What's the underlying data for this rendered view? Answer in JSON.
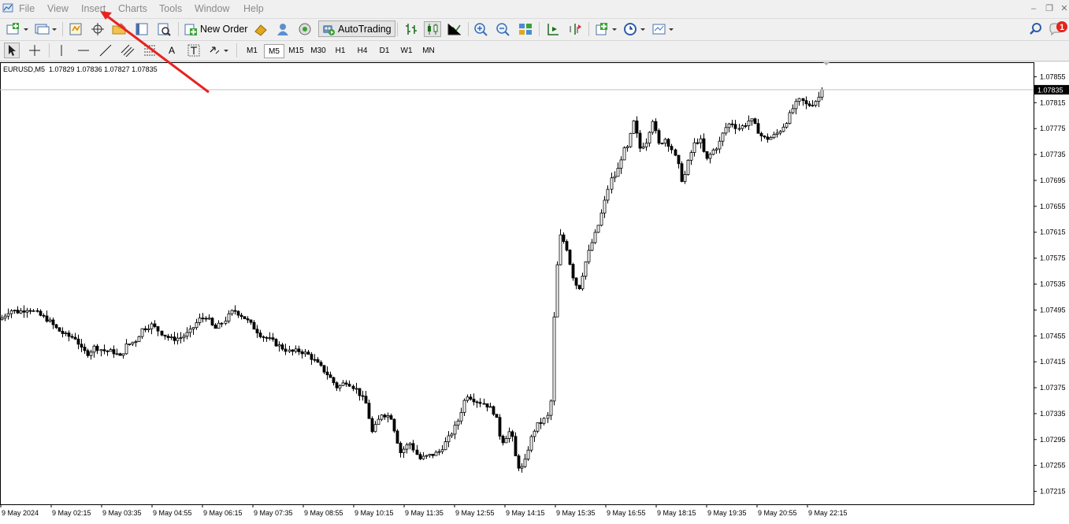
{
  "menu": {
    "file": "File",
    "view": "View",
    "insert": "Insert",
    "charts": "Charts",
    "tools": "Tools",
    "window": "Window",
    "help": "Help"
  },
  "toolbar": {
    "new_order": "New Order",
    "autotrading": "AutoTrading",
    "notification_count": "1"
  },
  "timeframes": [
    {
      "label": "M1",
      "active": false
    },
    {
      "label": "M5",
      "active": true
    },
    {
      "label": "M15",
      "active": false
    },
    {
      "label": "M30",
      "active": false
    },
    {
      "label": "H1",
      "active": false
    },
    {
      "label": "H4",
      "active": false
    },
    {
      "label": "D1",
      "active": false
    },
    {
      "label": "W1",
      "active": false
    },
    {
      "label": "MN",
      "active": false
    }
  ],
  "drawing_tools": {
    "text_tool": "A"
  },
  "chart": {
    "symbol_info": "EURUSD,M5  1.07829 1.07836 1.07827 1.07835",
    "current_price": "1.07835",
    "colors": {
      "annotation_arrow": "#e8231f",
      "notification": "#e3241c"
    }
  },
  "chart_data": {
    "type": "candlestick",
    "symbol": "EURUSD",
    "timeframe": "M5",
    "ohlc": {
      "open": 1.07829,
      "high": 1.07836,
      "low": 1.07827,
      "close": 1.07835
    },
    "ylim": [
      1.07195,
      1.07875
    ],
    "y_ticks": [
      "1.07855",
      "1.07815",
      "1.07775",
      "1.07735",
      "1.07695",
      "1.07655",
      "1.07615",
      "1.07575",
      "1.07535",
      "1.07495",
      "1.07455",
      "1.07415",
      "1.07375",
      "1.07335",
      "1.07295",
      "1.07255",
      "1.07215"
    ],
    "x_ticks": [
      "9 May 2024",
      "9 May 02:15",
      "9 May 03:35",
      "9 May 04:55",
      "9 May 06:15",
      "9 May 07:35",
      "9 May 08:55",
      "9 May 10:15",
      "9 May 11:35",
      "9 May 12:55",
      "9 May 14:15",
      "9 May 15:35",
      "9 May 16:55",
      "9 May 18:15",
      "9 May 19:35",
      "9 May 20:55",
      "9 May 22:15"
    ],
    "close_path": [
      [
        0,
        1.0748
      ],
      [
        12,
        1.07495
      ],
      [
        24,
        1.07492
      ],
      [
        36,
        1.07498
      ],
      [
        48,
        1.07488
      ],
      [
        60,
        1.0748
      ],
      [
        72,
        1.07465
      ],
      [
        84,
        1.07455
      ],
      [
        96,
        1.07452
      ],
      [
        104,
        1.07432
      ],
      [
        112,
        1.07428
      ],
      [
        120,
        1.07438
      ],
      [
        132,
        1.07432
      ],
      [
        144,
        1.0743
      ],
      [
        152,
        1.07422
      ],
      [
        160,
        1.0744
      ],
      [
        172,
        1.07448
      ],
      [
        180,
        1.07465
      ],
      [
        192,
        1.07472
      ],
      [
        204,
        1.0746
      ],
      [
        216,
        1.0745
      ],
      [
        228,
        1.07452
      ],
      [
        240,
        1.0746
      ],
      [
        252,
        1.0748
      ],
      [
        262,
        1.07485
      ],
      [
        272,
        1.07465
      ],
      [
        284,
        1.07478
      ],
      [
        296,
        1.07495
      ],
      [
        308,
        1.07485
      ],
      [
        320,
        1.0747
      ],
      [
        332,
        1.07455
      ],
      [
        344,
        1.07448
      ],
      [
        356,
        1.07438
      ],
      [
        368,
        1.0743
      ],
      [
        380,
        1.07432
      ],
      [
        392,
        1.07425
      ],
      [
        404,
        1.0741
      ],
      [
        416,
        1.07395
      ],
      [
        428,
        1.07375
      ],
      [
        440,
        1.07385
      ],
      [
        452,
        1.07372
      ],
      [
        464,
        1.0735
      ],
      [
        472,
        1.07305
      ],
      [
        484,
        1.07335
      ],
      [
        496,
        1.0733
      ],
      [
        508,
        1.07275
      ],
      [
        520,
        1.0729
      ],
      [
        532,
        1.07265
      ],
      [
        544,
        1.0727
      ],
      [
        556,
        1.07275
      ],
      [
        568,
        1.07295
      ],
      [
        580,
        1.0732
      ],
      [
        592,
        1.07365
      ],
      [
        604,
        1.07355
      ],
      [
        616,
        1.0735
      ],
      [
        628,
        1.07335
      ],
      [
        636,
        1.0729
      ],
      [
        648,
        1.0731
      ],
      [
        656,
        1.07255
      ],
      [
        664,
        1.0725
      ],
      [
        672,
        1.0729
      ],
      [
        680,
        1.07315
      ],
      [
        690,
        1.07325
      ],
      [
        698,
        1.07335
      ],
      [
        704,
        1.07525
      ],
      [
        710,
        1.0761
      ],
      [
        718,
        1.07595
      ],
      [
        726,
        1.0755
      ],
      [
        734,
        1.07525
      ],
      [
        742,
        1.07565
      ],
      [
        750,
        1.07595
      ],
      [
        758,
        1.0762
      ],
      [
        766,
        1.07655
      ],
      [
        774,
        1.07695
      ],
      [
        782,
        1.07705
      ],
      [
        790,
        1.0774
      ],
      [
        796,
        1.07745
      ],
      [
        804,
        1.07785
      ],
      [
        812,
        1.07745
      ],
      [
        820,
        1.07755
      ],
      [
        828,
        1.0779
      ],
      [
        836,
        1.0775
      ],
      [
        844,
        1.0776
      ],
      [
        852,
        1.07745
      ],
      [
        860,
        1.0772
      ],
      [
        866,
        1.0769
      ],
      [
        872,
        1.0772
      ],
      [
        880,
        1.0775
      ],
      [
        888,
        1.0776
      ],
      [
        896,
        1.07725
      ],
      [
        904,
        1.0774
      ],
      [
        912,
        1.0775
      ],
      [
        920,
        1.07775
      ],
      [
        928,
        1.07785
      ],
      [
        936,
        1.07775
      ],
      [
        944,
        1.0778
      ],
      [
        952,
        1.0779
      ],
      [
        960,
        1.07775
      ],
      [
        968,
        1.0776
      ],
      [
        976,
        1.0776
      ],
      [
        984,
        1.07765
      ],
      [
        992,
        1.07775
      ],
      [
        1000,
        1.0779
      ],
      [
        1008,
        1.0781
      ],
      [
        1016,
        1.0782
      ],
      [
        1024,
        1.0781
      ],
      [
        1032,
        1.07815
      ],
      [
        1038,
        1.07822
      ],
      [
        1045,
        1.07835
      ]
    ]
  }
}
